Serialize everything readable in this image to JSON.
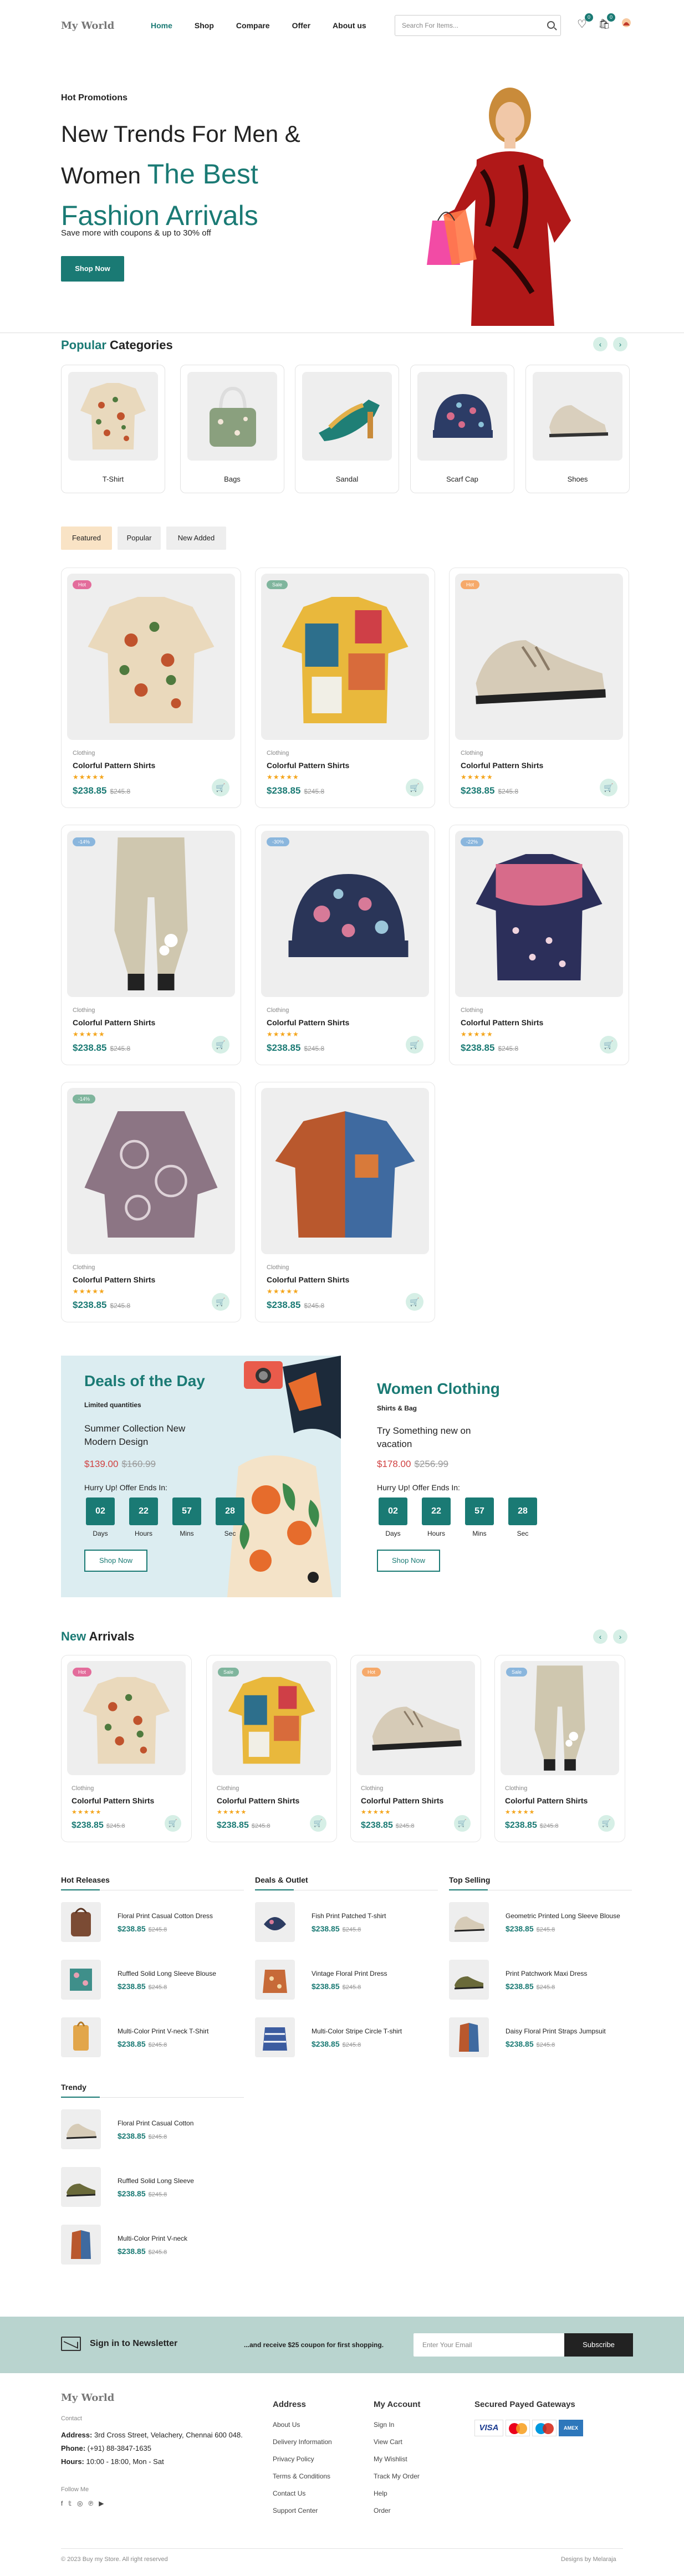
{
  "header": {
    "logo": "My World",
    "nav": [
      "Home",
      "Shop",
      "Compare",
      "Offer",
      "About us"
    ],
    "search_placeholder": "Search For Items...",
    "wishlist_count": "0",
    "cart_count": "0"
  },
  "hero": {
    "small": "Hot Promotions",
    "title_line1": "New Trends For Men &",
    "title_line2a": "Women ",
    "title_line2b": "The Best",
    "title_line3": "Fashion Arrivals",
    "subtitle": "Save more with coupons & up to 30% off",
    "button": "Shop Now"
  },
  "categories": {
    "title_a": "Popular",
    "title_b": " Categories",
    "items": [
      "T-Shirt",
      "Bags",
      "Sandal",
      "Scarf Cap",
      "Shoes"
    ]
  },
  "tabs": [
    "Featured",
    "Popular",
    "New Added"
  ],
  "products": [
    {
      "tag": "Hot",
      "tagcolor": "#e36c9b",
      "category": "Clothing",
      "name": "Colorful Pattern Shirts",
      "stars": "★★★★★",
      "price": "$238.85",
      "old": "$245.8"
    },
    {
      "tag": "Sale",
      "tagcolor": "#7fb59d",
      "category": "Clothing",
      "name": "Colorful Pattern Shirts",
      "stars": "★★★★★",
      "price": "$238.85",
      "old": "$245.8"
    },
    {
      "tag": "Hot",
      "tagcolor": "#f6a96a",
      "category": "Clothing",
      "name": "Colorful Pattern Shirts",
      "stars": "★★★★★",
      "price": "$238.85",
      "old": "$245.8"
    },
    {
      "tag": "-14%",
      "tagcolor": "#8ab6dd",
      "category": "Clothing",
      "name": "Colorful Pattern Shirts",
      "stars": "★★★★★",
      "price": "$238.85",
      "old": "$245.8"
    },
    {
      "tag": "-30%",
      "tagcolor": "#8ab6dd",
      "category": "Clothing",
      "name": "Colorful Pattern Shirts",
      "stars": "★★★★★",
      "price": "$238.85",
      "old": "$245.8"
    },
    {
      "tag": "-22%",
      "tagcolor": "#8ab6dd",
      "category": "Clothing",
      "name": "Colorful Pattern Shirts",
      "stars": "★★★★★",
      "price": "$238.85",
      "old": "$245.8"
    },
    {
      "tag": "-14%",
      "tagcolor": "#7fb59d",
      "category": "Clothing",
      "name": "Colorful Pattern Shirts",
      "stars": "★★★★★",
      "price": "$238.85",
      "old": "$245.8"
    },
    {
      "tag": "",
      "tagcolor": "",
      "category": "Clothing",
      "name": "Colorful Pattern Shirts",
      "stars": "★★★★★",
      "price": "$238.85",
      "old": "$245.8"
    }
  ],
  "deals": {
    "left": {
      "title": "Deals of the Day",
      "sub": "Limited quantities",
      "desc": "Summer Collection New Modern Design",
      "price": "$139.00",
      "old": "$160.99",
      "hurry": "Hurry Up! Offer Ends In:",
      "button": "Shop Now"
    },
    "right": {
      "title": "Women Clothing",
      "sub": "Shirts & Bag",
      "desc": "Try Something new on vacation",
      "price": "$178.00",
      "old": "$256.99",
      "hurry": "Hurry Up! Offer Ends In:",
      "button": "Shop Now"
    },
    "countdown": {
      "days": "02",
      "hours": "22",
      "mins": "57",
      "sec": "28",
      "l_days": "Days",
      "l_hours": "Hours",
      "l_mins": "Mins",
      "l_sec": "Sec"
    }
  },
  "arrivals": {
    "title_a": "New",
    "title_b": " Arrivals",
    "items": [
      {
        "tag": "Hot",
        "tagcolor": "#e36c9b",
        "category": "Clothing",
        "name": "Colorful Pattern Shirts",
        "stars": "★★★★★",
        "price": "$238.85",
        "old": "$245.8"
      },
      {
        "tag": "Sale",
        "tagcolor": "#7fb59d",
        "category": "Clothing",
        "name": "Colorful Pattern Shirts",
        "stars": "★★★★★",
        "price": "$238.85",
        "old": "$245.8"
      },
      {
        "tag": "Hot",
        "tagcolor": "#f6a96a",
        "category": "Clothing",
        "name": "Colorful Pattern Shirts",
        "stars": "★★★★★",
        "price": "$238.85",
        "old": "$245.8"
      },
      {
        "tag": "Sale",
        "tagcolor": "#8ab6dd",
        "category": "Clothing",
        "name": "Colorful Pattern Shirts",
        "stars": "★★★★★",
        "price": "$238.85",
        "old": "$245.8"
      }
    ]
  },
  "lists": {
    "hot": {
      "title": "Hot Releases",
      "items": [
        {
          "name": "Floral Print Casual Cotton Dress",
          "price": "$238.85",
          "old": "$245.8"
        },
        {
          "name": "Ruffled Solid Long Sleeve Blouse",
          "price": "$238.85",
          "old": "$245.8"
        },
        {
          "name": "Multi-Color Print V-neck T-Shirt",
          "price": "$238.85",
          "old": "$245.8"
        }
      ]
    },
    "deals": {
      "title": "Deals & Outlet",
      "items": [
        {
          "name": "Fish Print Patched T-shirt",
          "price": "$238.85",
          "old": "$245.8"
        },
        {
          "name": "Vintage Floral Print Dress",
          "price": "$238.85",
          "old": "$245.8"
        },
        {
          "name": "Multi-Color Stripe Circle T-shirt",
          "price": "$238.85",
          "old": "$245.8"
        }
      ]
    },
    "top": {
      "title": "Top Selling",
      "items": [
        {
          "name": "Geometric Printed Long Sleeve Blouse",
          "price": "$238.85",
          "old": "$245.8"
        },
        {
          "name": "Print Patchwork Maxi Dress",
          "price": "$238.85",
          "old": "$245.8"
        },
        {
          "name": "Daisy Floral Print Straps Jumpsuit",
          "price": "$238.85",
          "old": "$245.8"
        }
      ]
    },
    "trendy": {
      "title": "Trendy",
      "items": [
        {
          "name": "Floral Print Casual Cotton",
          "price": "$238.85",
          "old": "$245.8"
        },
        {
          "name": "Ruffled Solid Long Sleeve",
          "price": "$238.85",
          "old": "$245.8"
        },
        {
          "name": "Multi-Color Print V-neck",
          "price": "$238.85",
          "old": "$245.8"
        }
      ]
    }
  },
  "newsletter": {
    "title": "Sign in to Newsletter",
    "text": "...and receive $25 coupon for first shopping.",
    "placeholder": "Enter Your Email",
    "button": "Subscribe"
  },
  "footer": {
    "logo": "My World",
    "contact_label": "Contact",
    "address_label": "Address:",
    "address": " 3rd Cross Street, Velachery, Chennai 600 048.",
    "phone_label": "Phone:",
    "phone": " (+91) 88-3847-1635",
    "hours_label": "Hours:",
    "hours": " 10:00 - 18:00, Mon - Sat",
    "follow": "Follow Me",
    "address_col": {
      "title": "Address",
      "links": [
        "About Us",
        "Delivery Information",
        "Privacy Policy",
        "Terms & Conditions",
        "Contact Us",
        "Support Center"
      ]
    },
    "account_col": {
      "title": "My Account",
      "links": [
        "Sign In",
        "View Cart",
        "My Wishlist",
        "Track My Order",
        "Help",
        "Order"
      ]
    },
    "payments_title": "Secured Payed Gateways",
    "payments": [
      "VISA",
      "MC",
      "Maestro",
      "AMEX"
    ],
    "copyright": "© 2023 Buy my Store. All right reserved",
    "credit": "Designs by Melaraja"
  }
}
